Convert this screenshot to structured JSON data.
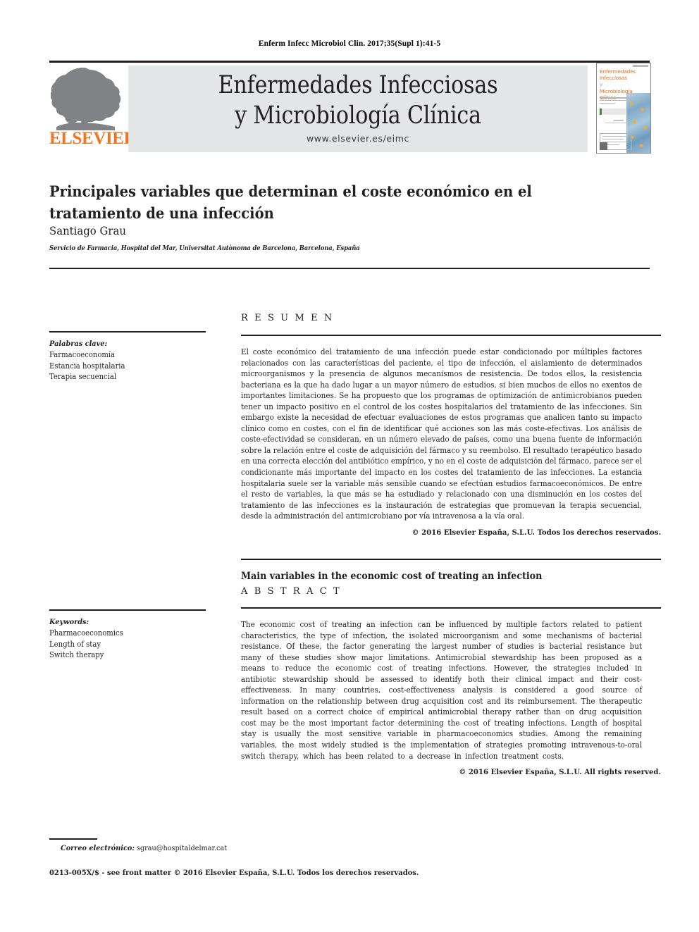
{
  "running_head": "Enferm Infecc Microbiol Clin. 2017;35(Supl 1):41-5",
  "masthead": {
    "publisher": "ELSEVIER",
    "journal_title_line1": "Enfermedades Infecciosas",
    "journal_title_line2": "y Microbiología Clínica",
    "url": "www.elsevier.es/eimc",
    "cover": {
      "line1": "Enfermedades",
      "line2": "Infecciosas",
      "line3_a": "y",
      "line3_b": "Microbiología",
      "line4": "Clínica"
    }
  },
  "article": {
    "title": "Principales variables que determinan el coste económico en el tratamiento de una infección",
    "author": "Santiago Grau",
    "affiliation": "Servicio de Farmacia, Hospital del Mar, Universitat Autònoma de Barcelona, Barcelona, España"
  },
  "keywords_es": {
    "heading": "Palabras clave:",
    "items": [
      "Farmacoeconomía",
      "Estancia hospitalaria",
      "Terapia secuencial"
    ]
  },
  "keywords_en": {
    "heading": "Keywords:",
    "items": [
      "Pharmacoeconomics",
      "Length of stay",
      "Switch therapy"
    ]
  },
  "resumen": {
    "label": "R E S U M E N",
    "body": "El coste económico del tratamiento de una infección puede estar condicionado por múltiples factores relacionados con las características del paciente, el tipo de infección, el aislamiento de determinados microorganismos y la presencia de algunos mecanismos de resistencia. De todos ellos, la resistencia bacteriana es la que ha dado lugar a un mayor número de estudios, si bien muchos de ellos no exentos de importantes limitaciones. Se ha propuesto que los programas de optimización de antimicrobianos pueden tener un impacto positivo en el control de los costes hospitalarios del tratamiento de las infecciones. Sin embargo existe la necesidad de efectuar evaluaciones de estos programas que analicen tanto su impacto clínico como en costes, con el fin de identificar qué acciones son las más coste-efectivas. Los análisis de coste-efectividad se consideran, en un número elevado de países, como una buena fuente de información sobre la relación entre el coste de adquisición del fármaco y su reembolso. El resultado terapéutico basado en una correcta elección del antibiótico empírico, y no en el coste de adquisición del fármaco, parece ser el condicionante más importante del impacto en los costes del tratamiento de las infecciones. La estancia hospitalaria suele ser la variable más sensible cuando se efectúan estudios farmacoeconómicos. De entre el resto de variables, la que más se ha estudiado y relacionado con una disminución en los costes del tratamiento de las infecciones es la instauración de estrategias que promuevan la terapia secuencial, desde la administración del antimicrobiano por vía intravenosa a la vía oral.",
    "copyright": "© 2016 Elsevier España, S.L.U. Todos los derechos reservados."
  },
  "abstract": {
    "title": "Main variables in the economic cost of treating an infection",
    "label": "A B S T R A C T",
    "body": "The economic cost of treating an infection can be influenced by multiple factors related to patient characteristics, the type of infection, the isolated microorganism and some mechanisms of bacterial resistance. Of these, the factor generating the largest number of studies is bacterial resistance but many of these studies show major limitations. Antimicrobial stewardship has been proposed as a means to reduce the economic cost of treating infections. However, the strategies included in antibiotic stewardship should be assessed to identify both their clinical impact and their cost-effectiveness. In many countries, cost-effectiveness analysis is considered a good source of information on the relationship between drug acquisition cost and its reimbursement. The therapeutic result based on a correct choice of empirical antimicrobial therapy rather than on drug acquisition cost may be the most important factor determining the cost of treating infections. Length of hospital stay is usually the most sensitive variable in pharmacoeconomics studies. Among the remaining variables, the most widely studied is the implementation of strategies promoting intravenous-to-oral switch therapy, which has been related to a decrease in infection treatment costs.",
    "copyright": "© 2016 Elsevier España, S.L.U. All rights reserved."
  },
  "footer": {
    "email_label": "Correo electrónico:",
    "email_value": "sgrau@hospitaldelmar.cat",
    "issn_line": "0213-005X/$ - see front matter © 2016 Elsevier España, S.L.U. Todos los derechos reservados."
  },
  "colors": {
    "elsevier_orange": "#ee7623",
    "masthead_band": "#e4e5e7",
    "ink": "#231f20"
  }
}
